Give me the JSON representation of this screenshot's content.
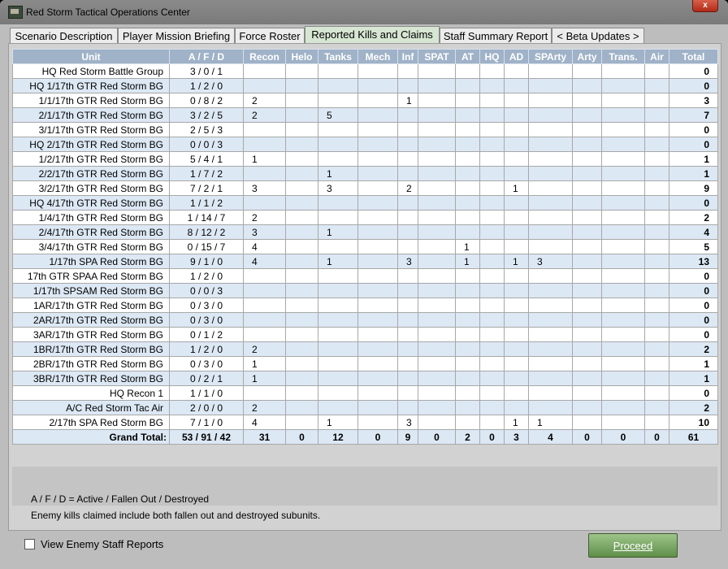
{
  "window": {
    "title": "Red Storm Tactical Operations Center",
    "close_glyph": "x"
  },
  "tabs": [
    {
      "label": "Scenario Description"
    },
    {
      "label": "Player Mission Briefing"
    },
    {
      "label": "Force Roster"
    },
    {
      "label": "Reported Kills and Claims"
    },
    {
      "label": "Staff Summary Report"
    },
    {
      "label": "< Beta Updates >"
    }
  ],
  "active_tab": "Reported Kills and Claims",
  "table": {
    "headers": [
      "Unit",
      "A / F / D",
      "Recon",
      "Helo",
      "Tanks",
      "Mech",
      "Inf",
      "SPAT",
      "AT",
      "HQ",
      "AD",
      "SPArty",
      "Arty",
      "Trans.",
      "Air",
      "Total"
    ],
    "rows": [
      {
        "unit": "HQ Red Storm Battle Group",
        "afd": "3 / 0 / 1",
        "vals": [
          "",
          "",
          "",
          "",
          "",
          "",
          "",
          "",
          "",
          "",
          "",
          "",
          ""
        ],
        "total": "0"
      },
      {
        "unit": "HQ 1/17th GTR Red Storm BG",
        "afd": "1 / 2 / 0",
        "vals": [
          "",
          "",
          "",
          "",
          "",
          "",
          "",
          "",
          "",
          "",
          "",
          "",
          ""
        ],
        "total": "0"
      },
      {
        "unit": "1/1/17th GTR Red Storm BG",
        "afd": "0 / 8 / 2",
        "vals": [
          "2",
          "",
          "",
          "",
          "1",
          "",
          "",
          "",
          "",
          "",
          "",
          "",
          ""
        ],
        "total": "3"
      },
      {
        "unit": "2/1/17th GTR Red Storm BG",
        "afd": "3 / 2 / 5",
        "vals": [
          "2",
          "",
          "5",
          "",
          "",
          "",
          "",
          "",
          "",
          "",
          "",
          "",
          ""
        ],
        "total": "7"
      },
      {
        "unit": "3/1/17th GTR Red Storm BG",
        "afd": "2 / 5 / 3",
        "vals": [
          "",
          "",
          "",
          "",
          "",
          "",
          "",
          "",
          "",
          "",
          "",
          "",
          ""
        ],
        "total": "0"
      },
      {
        "unit": "HQ 2/17th GTR Red Storm BG",
        "afd": "0 / 0 / 3",
        "vals": [
          "",
          "",
          "",
          "",
          "",
          "",
          "",
          "",
          "",
          "",
          "",
          "",
          ""
        ],
        "total": "0"
      },
      {
        "unit": "1/2/17th GTR Red Storm BG",
        "afd": "5 / 4 / 1",
        "vals": [
          "1",
          "",
          "",
          "",
          "",
          "",
          "",
          "",
          "",
          "",
          "",
          "",
          ""
        ],
        "total": "1"
      },
      {
        "unit": "2/2/17th GTR Red Storm BG",
        "afd": "1 / 7 / 2",
        "vals": [
          "",
          "",
          "1",
          "",
          "",
          "",
          "",
          "",
          "",
          "",
          "",
          "",
          ""
        ],
        "total": "1"
      },
      {
        "unit": "3/2/17th GTR Red Storm BG",
        "afd": "7 / 2 / 1",
        "vals": [
          "3",
          "",
          "3",
          "",
          "2",
          "",
          "",
          "",
          "1",
          "",
          "",
          "",
          ""
        ],
        "total": "9"
      },
      {
        "unit": "HQ 4/17th GTR Red Storm BG",
        "afd": "1 / 1 / 2",
        "vals": [
          "",
          "",
          "",
          "",
          "",
          "",
          "",
          "",
          "",
          "",
          "",
          "",
          ""
        ],
        "total": "0"
      },
      {
        "unit": "1/4/17th GTR Red Storm BG",
        "afd": "1 / 14 / 7",
        "vals": [
          "2",
          "",
          "",
          "",
          "",
          "",
          "",
          "",
          "",
          "",
          "",
          "",
          ""
        ],
        "total": "2"
      },
      {
        "unit": "2/4/17th GTR Red Storm BG",
        "afd": "8 / 12 / 2",
        "vals": [
          "3",
          "",
          "1",
          "",
          "",
          "",
          "",
          "",
          "",
          "",
          "",
          "",
          ""
        ],
        "total": "4"
      },
      {
        "unit": "3/4/17th GTR Red Storm BG",
        "afd": "0 / 15 / 7",
        "vals": [
          "4",
          "",
          "",
          "",
          "",
          "",
          "1",
          "",
          "",
          "",
          "",
          "",
          ""
        ],
        "total": "5"
      },
      {
        "unit": "1/17th SPA Red Storm BG",
        "afd": "9 / 1 / 0",
        "vals": [
          "4",
          "",
          "1",
          "",
          "3",
          "",
          "1",
          "",
          "1",
          "3",
          "",
          "",
          ""
        ],
        "total": "13"
      },
      {
        "unit": "17th GTR SPAA Red Storm BG",
        "afd": "1 / 2 / 0",
        "vals": [
          "",
          "",
          "",
          "",
          "",
          "",
          "",
          "",
          "",
          "",
          "",
          "",
          ""
        ],
        "total": "0"
      },
      {
        "unit": "1/17th SPSAM Red Storm BG",
        "afd": "0 / 0 / 3",
        "vals": [
          "",
          "",
          "",
          "",
          "",
          "",
          "",
          "",
          "",
          "",
          "",
          "",
          ""
        ],
        "total": "0"
      },
      {
        "unit": "1AR/17th GTR Red Storm BG",
        "afd": "0 / 3 / 0",
        "vals": [
          "",
          "",
          "",
          "",
          "",
          "",
          "",
          "",
          "",
          "",
          "",
          "",
          ""
        ],
        "total": "0"
      },
      {
        "unit": "2AR/17th GTR Red Storm BG",
        "afd": "0 / 3 / 0",
        "vals": [
          "",
          "",
          "",
          "",
          "",
          "",
          "",
          "",
          "",
          "",
          "",
          "",
          ""
        ],
        "total": "0"
      },
      {
        "unit": "3AR/17th GTR Red Storm BG",
        "afd": "0 / 1 / 2",
        "vals": [
          "",
          "",
          "",
          "",
          "",
          "",
          "",
          "",
          "",
          "",
          "",
          "",
          ""
        ],
        "total": "0"
      },
      {
        "unit": "1BR/17th GTR Red Storm BG",
        "afd": "1 / 2 / 0",
        "vals": [
          "2",
          "",
          "",
          "",
          "",
          "",
          "",
          "",
          "",
          "",
          "",
          "",
          ""
        ],
        "total": "2"
      },
      {
        "unit": "2BR/17th GTR Red Storm BG",
        "afd": "0 / 3 / 0",
        "vals": [
          "1",
          "",
          "",
          "",
          "",
          "",
          "",
          "",
          "",
          "",
          "",
          "",
          ""
        ],
        "total": "1"
      },
      {
        "unit": "3BR/17th GTR Red Storm BG",
        "afd": "0 / 2 / 1",
        "vals": [
          "1",
          "",
          "",
          "",
          "",
          "",
          "",
          "",
          "",
          "",
          "",
          "",
          ""
        ],
        "total": "1"
      },
      {
        "unit": "HQ Recon 1",
        "afd": "1 / 1 / 0",
        "vals": [
          "",
          "",
          "",
          "",
          "",
          "",
          "",
          "",
          "",
          "",
          "",
          "",
          ""
        ],
        "total": "0"
      },
      {
        "unit": "A/C Red Storm Tac Air",
        "afd": "2 / 0 / 0",
        "vals": [
          "2",
          "",
          "",
          "",
          "",
          "",
          "",
          "",
          "",
          "",
          "",
          "",
          ""
        ],
        "total": "2"
      },
      {
        "unit": "2/17th SPA Red Storm BG",
        "afd": "7 / 1 / 0",
        "vals": [
          "4",
          "",
          "1",
          "",
          "3",
          "",
          "",
          "",
          "1",
          "1",
          "",
          "",
          ""
        ],
        "total": "10"
      }
    ],
    "grand_total": {
      "label": "Grand Total:",
      "afd": "53 / 91 / 42",
      "vals": [
        "31",
        "0",
        "12",
        "0",
        "9",
        "0",
        "2",
        "0",
        "3",
        "4",
        "0",
        "0",
        "0"
      ],
      "total": "61"
    }
  },
  "legend": {
    "line1": "A / F / D = Active / Fallen Out / Destroyed",
    "line2": "Enemy kills claimed include both fallen out and destroyed subunits."
  },
  "footer": {
    "checkbox_label": "View Enemy Staff Reports",
    "checkbox_checked": false,
    "proceed_label": "Proceed"
  },
  "colors": {
    "header_bg": "#9fb2c8",
    "row_alt": "#dce8f4",
    "active_tab": "#d6e6d2",
    "proceed_button": "#6f9c5a",
    "close_button": "#c0402c"
  }
}
